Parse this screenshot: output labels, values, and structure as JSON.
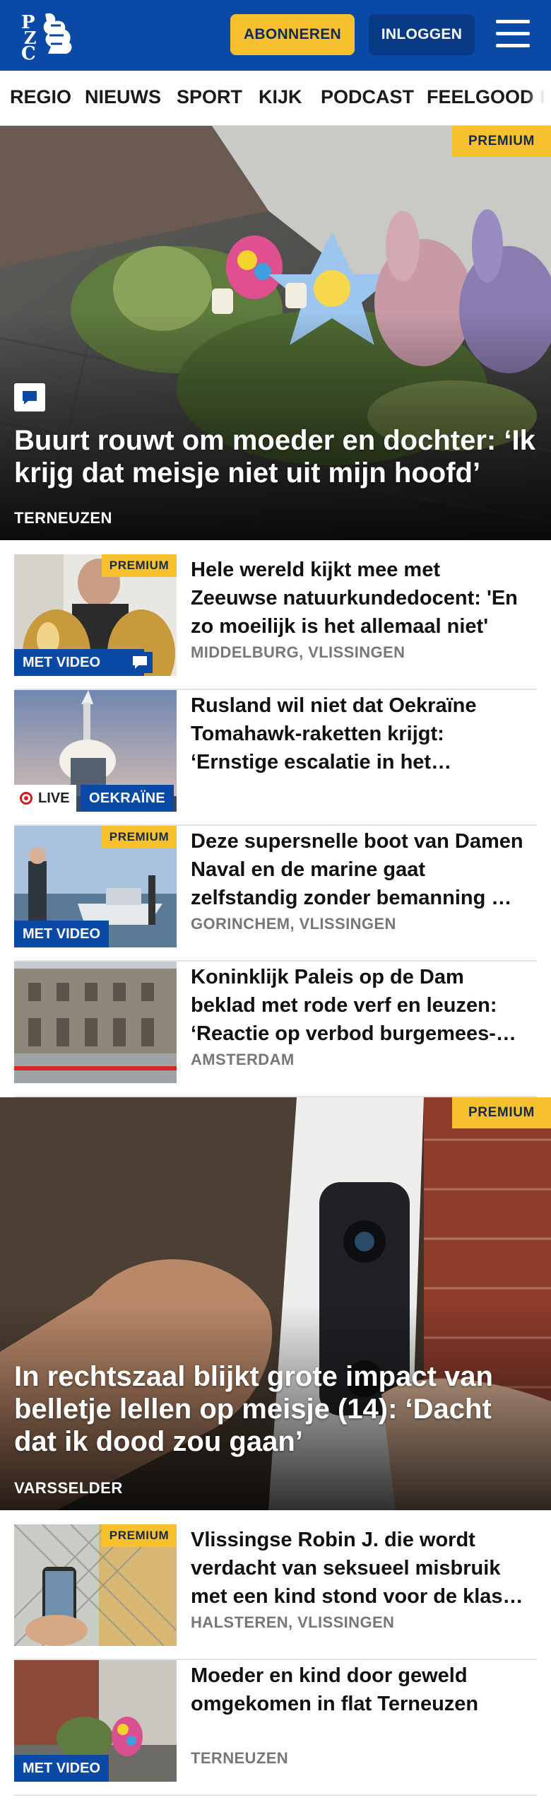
{
  "header": {
    "logo_text": "PZC",
    "subscribe_label": "ABONNEREN",
    "login_label": "INLOGGEN",
    "colors": {
      "brand": "#0a4aa6",
      "accent": "#f6c12c"
    }
  },
  "nav": {
    "items": [
      "REGIO",
      "NIEUWS",
      "SPORT",
      "KIJK",
      "PODCAST",
      "FEELGOOD",
      "I"
    ]
  },
  "lead": {
    "badge": "PREMIUM",
    "title": "Buurt rouwt om moeder en dochter: ‘Ik krijg dat meisje niet uit mijn hoofd’",
    "location": "TERNEUZEN",
    "icon": "comment-icon"
  },
  "articles": [
    {
      "badge": "PREMIUM",
      "title": "Hele wereld kijkt mee met Zeeuwse natuurkundedocent: 'En zo moeilijk is het allemaal niet'",
      "location": "MIDDELBURG, VLISSINGEN",
      "video_label": "MET VIDEO"
    },
    {
      "title": "Rusland wil niet dat Oekraïne Tomahawk-raketten krijgt: ‘Ernstige escalatie in het…",
      "live_label": "LIVE",
      "topic_label": "OEKRAÏNE"
    },
    {
      "badge": "PREMIUM",
      "title": "Deze supersnelle boot van Damen Naval en de marine gaat zelfstandig zonder bemanning …",
      "location": "GORINCHEM, VLISSINGEN",
      "video_label": "MET VIDEO"
    },
    {
      "title": "Koninklijk Paleis op de Dam beklad met rode verf en leuzen: ‘Reactie op verbod burgemees-…",
      "location": "AMSTERDAM"
    }
  ],
  "second_lead": {
    "badge": "PREMIUM",
    "title": "In rechtszaal blijkt grote impact van belletje lellen op meisje (14): ‘Dacht dat ik dood zou gaan’",
    "location": "VARSSELDER"
  },
  "more_articles": [
    {
      "badge": "PREMIUM",
      "title": "Vlissingse Robin J. die wordt verdacht van seksueel misbruik met een kind stond voor de klas…",
      "location": "HALSTEREN, VLISSINGEN"
    },
    {
      "title": "Moeder en kind door geweld omgekomen in flat Terneuzen",
      "location": "TERNEUZEN",
      "video_label": "MET VIDEO"
    }
  ]
}
